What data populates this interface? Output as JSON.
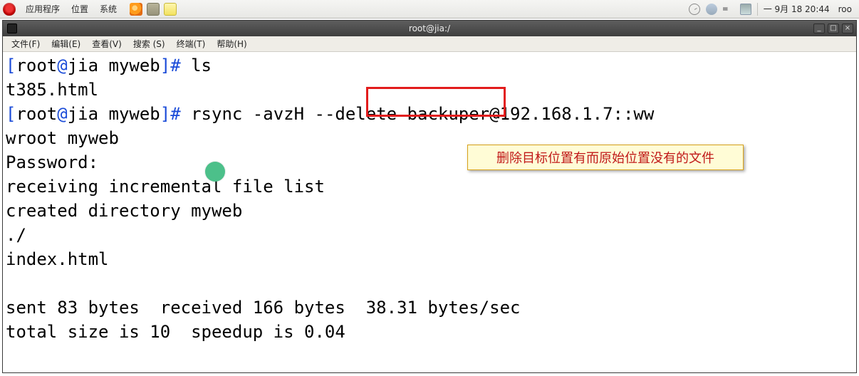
{
  "panel": {
    "menus": [
      "应用程序",
      "位置",
      "系统"
    ],
    "datetime": "一 9月  18 20:44",
    "user": "roo"
  },
  "titlebar": {
    "title": "root@jia:/"
  },
  "menubar": {
    "items": [
      "文件(F)",
      "编辑(E)",
      "查看(V)",
      "搜索 (S)",
      "终端(T)",
      "帮助(H)"
    ]
  },
  "terminal": {
    "lines": [
      {
        "kind": "prompt",
        "user": "root",
        "host": "jia",
        "cwd": "myweb",
        "cmd": " ls"
      },
      {
        "kind": "plain",
        "text": "t385.html"
      },
      {
        "kind": "prompt",
        "user": "root",
        "host": "jia",
        "cwd": "myweb",
        "cmd": " rsync -avzH --delete backuper@192.168.1.7::ww"
      },
      {
        "kind": "plain",
        "text": "wroot myweb"
      },
      {
        "kind": "plain",
        "text": "Password:"
      },
      {
        "kind": "plain",
        "text": "receiving incremental file list"
      },
      {
        "kind": "plain",
        "text": "created directory myweb"
      },
      {
        "kind": "plain",
        "text": "./"
      },
      {
        "kind": "plain",
        "text": "index.html"
      },
      {
        "kind": "plain",
        "text": ""
      },
      {
        "kind": "plain",
        "text": "sent 83 bytes  received 166 bytes  38.31 bytes/sec"
      },
      {
        "kind": "plain",
        "text": "total size is 10  speedup is 0.04"
      }
    ]
  },
  "annotations": {
    "highlight_target": "--delete",
    "callout_text": "删除目标位置有而原始位置没有的文件"
  },
  "win_buttons": {
    "min": "_",
    "max": "□",
    "close": "×"
  }
}
